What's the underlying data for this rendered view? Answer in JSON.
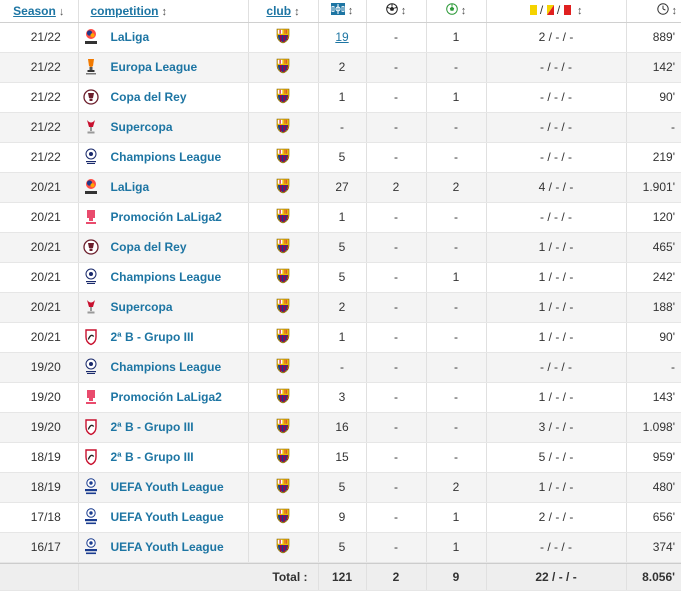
{
  "colors": {
    "link": "#1d75a3",
    "row_alt": "#f4f4f4",
    "total_bg": "#eeeeee",
    "barca_blue": "#1b3d8f",
    "barca_red": "#a50044",
    "barca_gold": "#edbb00",
    "yellow_card": "#f5d300",
    "red_card": "#e02020"
  },
  "header": {
    "season": "Season",
    "season_sort": "↓",
    "competition": "competition",
    "competition_sort": "↕",
    "club": "club",
    "club_sort": "↕",
    "apps_icon": "pitch-icon",
    "apps_sort": "↕",
    "goals_icon": "football-icon",
    "goals_sort": "↕",
    "assists_icon": "assist-ball-icon",
    "assists_sort": "↕",
    "cards_icon": "cards-icon",
    "cards_sep1": "/",
    "cards_sep2": "/",
    "cards_sort": "↕",
    "minutes_icon": "clock-icon",
    "minutes_sort": "↕"
  },
  "rows": [
    {
      "season": "21/22",
      "competition": "LaLiga",
      "logo": "laliga-logo",
      "apps": "19",
      "apps_link": true,
      "goals": "-",
      "assists": "1",
      "cards": "2 / - / -",
      "minutes": "889'"
    },
    {
      "season": "21/22",
      "competition": "Europa League",
      "logo": "europa-league-logo",
      "apps": "2",
      "apps_link": false,
      "goals": "-",
      "assists": "-",
      "cards": "- / - / -",
      "minutes": "142'"
    },
    {
      "season": "21/22",
      "competition": "Copa del Rey",
      "logo": "copa-del-rey-logo",
      "apps": "1",
      "apps_link": false,
      "goals": "-",
      "assists": "1",
      "cards": "- / - / -",
      "minutes": "90'"
    },
    {
      "season": "21/22",
      "competition": "Supercopa",
      "logo": "supercopa-logo",
      "apps": "-",
      "apps_link": false,
      "goals": "-",
      "assists": "-",
      "cards": "- / - / -",
      "minutes": "-"
    },
    {
      "season": "21/22",
      "competition": "Champions League",
      "logo": "champions-league-logo",
      "apps": "5",
      "apps_link": false,
      "goals": "-",
      "assists": "-",
      "cards": "- / - / -",
      "minutes": "219'"
    },
    {
      "season": "20/21",
      "competition": "LaLiga",
      "logo": "laliga-logo",
      "apps": "27",
      "apps_link": false,
      "goals": "2",
      "assists": "2",
      "cards": "4 / - / -",
      "minutes": "1.901'"
    },
    {
      "season": "20/21",
      "competition": "Promoción LaLiga2",
      "logo": "promocion-logo",
      "apps": "1",
      "apps_link": false,
      "goals": "-",
      "assists": "-",
      "cards": "- / - / -",
      "minutes": "120'"
    },
    {
      "season": "20/21",
      "competition": "Copa del Rey",
      "logo": "copa-del-rey-logo",
      "apps": "5",
      "apps_link": false,
      "goals": "-",
      "assists": "-",
      "cards": "1 / - / -",
      "minutes": "465'"
    },
    {
      "season": "20/21",
      "competition": "Champions League",
      "logo": "champions-league-logo",
      "apps": "5",
      "apps_link": false,
      "goals": "-",
      "assists": "1",
      "cards": "1 / - / -",
      "minutes": "242'"
    },
    {
      "season": "20/21",
      "competition": "Supercopa",
      "logo": "supercopa-logo",
      "apps": "2",
      "apps_link": false,
      "goals": "-",
      "assists": "-",
      "cards": "1 / - / -",
      "minutes": "188'"
    },
    {
      "season": "20/21",
      "competition": "2ª B - Grupo III",
      "logo": "segunda-b-logo",
      "apps": "1",
      "apps_link": false,
      "goals": "-",
      "assists": "-",
      "cards": "1 / - / -",
      "minutes": "90'"
    },
    {
      "season": "19/20",
      "competition": "Champions League",
      "logo": "champions-league-logo",
      "apps": "-",
      "apps_link": false,
      "goals": "-",
      "assists": "-",
      "cards": "- / - / -",
      "minutes": "-"
    },
    {
      "season": "19/20",
      "competition": "Promoción LaLiga2",
      "logo": "promocion-logo",
      "apps": "3",
      "apps_link": false,
      "goals": "-",
      "assists": "-",
      "cards": "1 / - / -",
      "minutes": "143'"
    },
    {
      "season": "19/20",
      "competition": "2ª B - Grupo III",
      "logo": "segunda-b-logo",
      "apps": "16",
      "apps_link": false,
      "goals": "-",
      "assists": "-",
      "cards": "3 / - / -",
      "minutes": "1.098'"
    },
    {
      "season": "18/19",
      "competition": "2ª B - Grupo III",
      "logo": "segunda-b-logo",
      "apps": "15",
      "apps_link": false,
      "goals": "-",
      "assists": "-",
      "cards": "5 / - / -",
      "minutes": "959'"
    },
    {
      "season": "18/19",
      "competition": "UEFA Youth League",
      "logo": "youth-league-logo",
      "apps": "5",
      "apps_link": false,
      "goals": "-",
      "assists": "2",
      "cards": "1 / - / -",
      "minutes": "480'"
    },
    {
      "season": "17/18",
      "competition": "UEFA Youth League",
      "logo": "youth-league-logo",
      "apps": "9",
      "apps_link": false,
      "goals": "-",
      "assists": "1",
      "cards": "2 / - / -",
      "minutes": "656'"
    },
    {
      "season": "16/17",
      "competition": "UEFA Youth League",
      "logo": "youth-league-logo",
      "apps": "5",
      "apps_link": false,
      "goals": "-",
      "assists": "1",
      "cards": "- / - / -",
      "minutes": "374'"
    }
  ],
  "total": {
    "label": "Total :",
    "apps": "121",
    "goals": "2",
    "assists": "9",
    "cards": "22 / - / -",
    "minutes": "8.056'"
  }
}
